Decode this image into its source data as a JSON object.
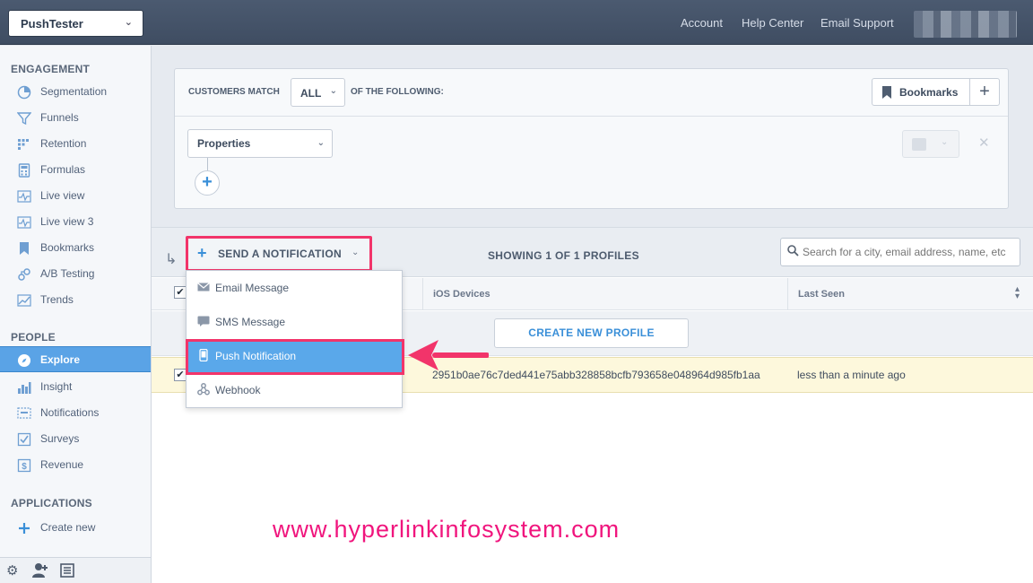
{
  "topbar": {
    "project": "PushTester",
    "links": [
      "Account",
      "Help Center",
      "Email Support"
    ]
  },
  "sidebar": {
    "sections": [
      {
        "title": "ENGAGEMENT",
        "items": [
          "Segmentation",
          "Funnels",
          "Retention",
          "Formulas",
          "Live view",
          "Live view 3",
          "Bookmarks",
          "A/B Testing",
          "Trends"
        ]
      },
      {
        "title": "PEOPLE",
        "items": [
          "Explore",
          "Insight",
          "Notifications",
          "Surveys",
          "Revenue"
        ]
      },
      {
        "title": "APPLICATIONS",
        "items": [
          "Create new"
        ]
      }
    ],
    "active_item": "Explore"
  },
  "query": {
    "customers_match": "CUSTOMERS MATCH",
    "match_value": "ALL",
    "of_following": "OF THE FOLLOWING:",
    "bookmarks": "Bookmarks",
    "property_select": "Properties"
  },
  "results": {
    "send_notification": "SEND A NOTIFICATION",
    "showing": "SHOWING 1 OF 1 PROFILES",
    "search_placeholder": "Search for a city, email address, name, etc",
    "columns": [
      "iOS Devices",
      "Last Seen"
    ],
    "create_profile": "CREATE NEW PROFILE",
    "row": {
      "ios_device": "2951b0ae76c7ded441e75abb328858bcfb793658e048964d985fb1aa",
      "last_seen": "less than a minute ago"
    }
  },
  "dropdown": {
    "items": [
      "Email Message",
      "SMS Message",
      "Push Notification",
      "Webhook"
    ],
    "highlighted": "Push Notification"
  },
  "watermark": "www.hyperlinkinfosystem.com",
  "colors": {
    "accent": "#5aa3e6",
    "highlight_border": "#f2346a",
    "watermark": "#f0157d"
  }
}
